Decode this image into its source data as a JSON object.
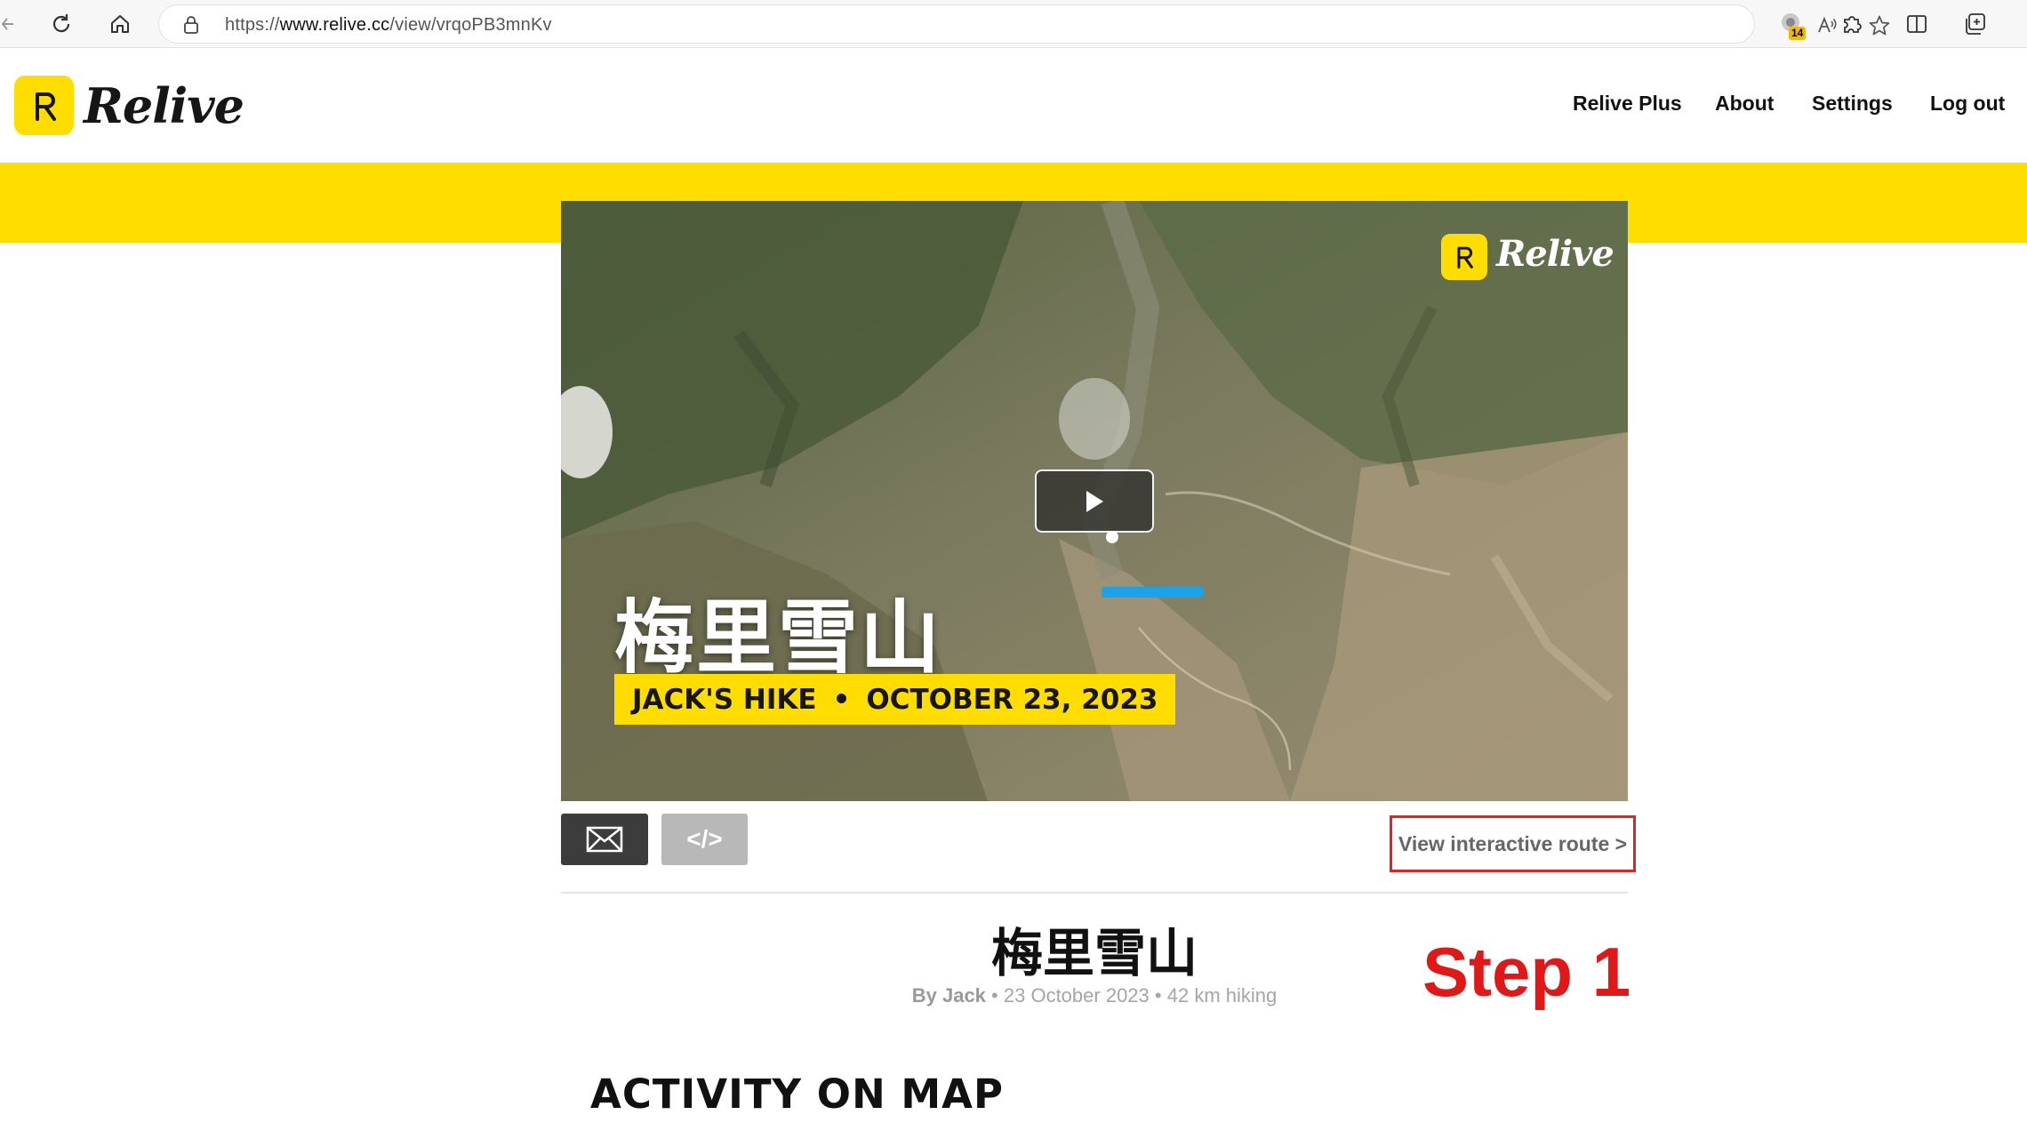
{
  "browser": {
    "url_prefix": "https://",
    "url_host": "www.relive.cc",
    "url_path": "/view/vrqoPB3mnKv",
    "extension_badge": "14"
  },
  "header": {
    "logo_text": "Relive",
    "nav": [
      "Relive Plus",
      "About",
      "Settings",
      "Log out"
    ]
  },
  "video": {
    "logo_text": "Relive",
    "title": "梅里雪山",
    "tag_name": "JACK'S HIKE",
    "tag_separator": "•",
    "tag_date": "OCTOBER 23, 2023",
    "route_color": "#1aa3e8"
  },
  "controls": {
    "embed_label": "</>",
    "view_route_label": "View interactive route >"
  },
  "activity": {
    "title": "梅里雪山",
    "by_label": "By Jack",
    "date": "23 October 2023",
    "distance": "42 km hiking",
    "separator": "•"
  },
  "annotation": {
    "step_label": "Step 1",
    "color": "#e01818"
  },
  "sections": {
    "map_heading": "ACTIVITY ON MAP"
  },
  "colors": {
    "brand_yellow": "#ffdd00",
    "dark": "#161616"
  }
}
